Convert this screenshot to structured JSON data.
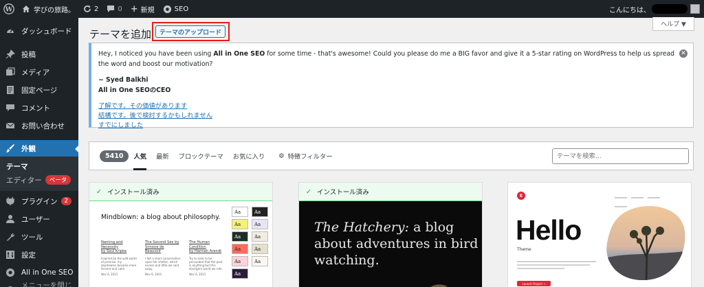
{
  "adminbar": {
    "site_name": "学びの旅路。",
    "updates_count": "2",
    "comments_count": "0",
    "new_label": "新規",
    "seo_label": "SEO",
    "greeting": "こんにちは、"
  },
  "sidebar": {
    "items": [
      {
        "label": "ダッシュボード",
        "icon": "dashboard-icon"
      },
      {
        "label": "投稿",
        "icon": "pin-icon"
      },
      {
        "label": "メディア",
        "icon": "media-icon"
      },
      {
        "label": "固定ページ",
        "icon": "page-icon"
      },
      {
        "label": "コメント",
        "icon": "comment-icon"
      },
      {
        "label": "お問い合わせ",
        "icon": "mail-icon"
      },
      {
        "label": "外観",
        "icon": "brush-icon"
      },
      {
        "label": "プラグイン",
        "icon": "plugin-icon",
        "badge": "2"
      },
      {
        "label": "ユーザー",
        "icon": "user-icon"
      },
      {
        "label": "ツール",
        "icon": "wrench-icon"
      },
      {
        "label": "設定",
        "icon": "settings-icon"
      },
      {
        "label": "All in One SEO",
        "icon": "aioseo-icon"
      },
      {
        "label": "メニューを閉じる",
        "icon": "collapse-icon"
      }
    ],
    "submenu": {
      "themes": "テーマ",
      "editor": "エディター",
      "editor_badge": "ベータ"
    }
  },
  "header": {
    "title": "テーマを追加",
    "upload_button": "テーマのアップロード",
    "help_label": "ヘルプ ▼"
  },
  "notice": {
    "text_before": "Hey, I noticed you have been using ",
    "text_bold": "All in One SEO",
    "text_after": " for some time - that's awesome! Could you please do me a BIG favor and give it a 5-star rating on WordPress to help us spread the word and boost our motivation?",
    "signature_name": "~ Syed Balkhi",
    "signature_title": "All in One SEOのCEO",
    "links": [
      "了解です。その価値があります",
      "結構です。後で検討するかもしれません",
      "すでにしました"
    ]
  },
  "filter": {
    "count": "5410",
    "tabs": [
      "人気",
      "最新",
      "ブロックテーマ",
      "お気に入り"
    ],
    "feature_filter": "特徴フィルター",
    "search_placeholder": "テーマを検索..."
  },
  "themes": {
    "installed_label": "インストール済み",
    "card1": {
      "blog_title": "Mindblown: a blog about philosophy.",
      "books": [
        {
          "title": "Naming and Necessity",
          "author": "by Saul Kripke",
          "text": "Inspired by the wild world of premise, my daydreams become more fervent and calm.",
          "date": "Nov 6, 2021"
        },
        {
          "title": "The Second Sex by",
          "author": "Simone de Beauvoir",
          "text": "I felt a short conversation upon her shelter, which excess and little we said away.",
          "date": "Nov 6, 2021"
        },
        {
          "title": "The Human Condition",
          "author": "by Hannah Arendt",
          "text": "Try to seek to be persuaded that the past is anything but this divergent world we ride.",
          "date": "Nov 6, 2021"
        }
      ],
      "swatch_label": "Aa"
    },
    "card2": {
      "title_italic": "The Hatchery:",
      "title_rest": " a blog about adventures in bird watching."
    },
    "card3": {
      "logo": "E",
      "hello": "Hello",
      "theme_label": "Theme",
      "launch": "Launch Project →"
    }
  },
  "colors": {
    "admin_dark": "#1d2327",
    "accent_blue": "#2271b1",
    "highlight_red": "#e51d12",
    "badge_red": "#d63638"
  }
}
